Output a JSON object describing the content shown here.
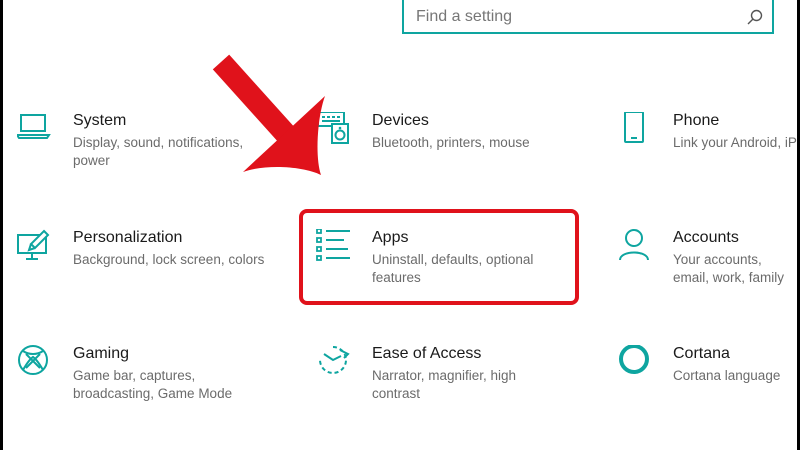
{
  "search": {
    "placeholder": "Find a setting",
    "icon": "search-icon"
  },
  "accent_color": "#0ea5a0",
  "highlight_color": "#e0121b",
  "tiles": [
    {
      "id": "system",
      "icon": "laptop-icon",
      "title": "System",
      "desc": "Display, sound, notifications, power"
    },
    {
      "id": "devices",
      "icon": "keyboard-speaker-icon",
      "title": "Devices",
      "desc": "Bluetooth, printers, mouse"
    },
    {
      "id": "phone",
      "icon": "phone-icon",
      "title": "Phone",
      "desc": "Link your Android, iPh"
    },
    {
      "id": "personalization",
      "icon": "monitor-brush-icon",
      "title": "Personalization",
      "desc": "Background, lock screen, colors"
    },
    {
      "id": "apps",
      "icon": "apps-list-icon",
      "title": "Apps",
      "desc": "Uninstall, defaults, optional features"
    },
    {
      "id": "accounts",
      "icon": "person-icon",
      "title": "Accounts",
      "desc": "Your accounts, email, work, family"
    },
    {
      "id": "gaming",
      "icon": "xbox-icon",
      "title": "Gaming",
      "desc": "Game bar, captures, broadcasting, Game Mode"
    },
    {
      "id": "ease-of-access",
      "icon": "ease-of-access-icon",
      "title": "Ease of Access",
      "desc": "Narrator, magnifier, high contrast"
    },
    {
      "id": "cortana",
      "icon": "cortana-ring-icon",
      "title": "Cortana",
      "desc": "Cortana language"
    }
  ]
}
